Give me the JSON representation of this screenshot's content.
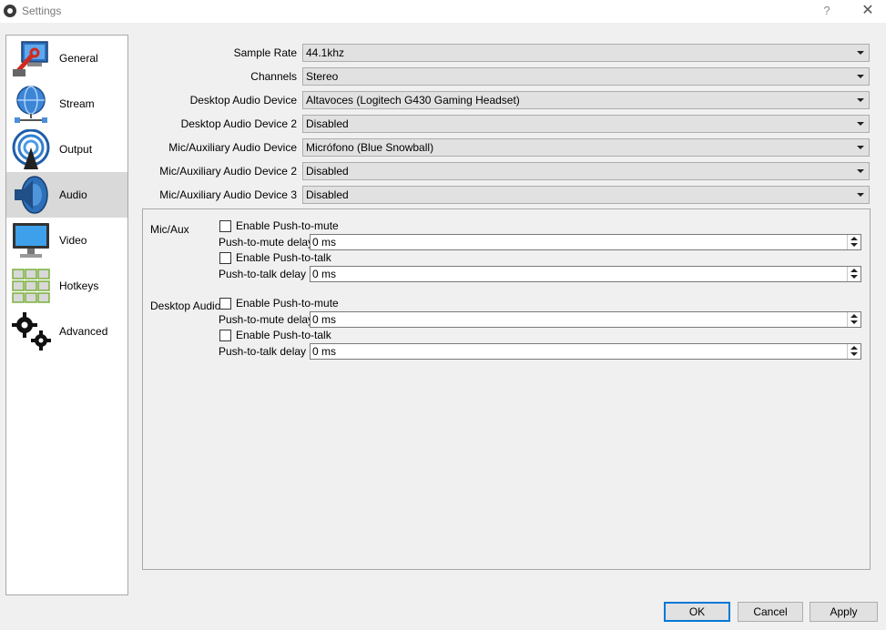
{
  "window": {
    "title": "Settings",
    "help_label": "?",
    "close_label": "✕"
  },
  "sidebar": {
    "items": [
      {
        "label": "General",
        "icon": "computer-wrench-icon",
        "selected": false
      },
      {
        "label": "Stream",
        "icon": "globe-network-icon",
        "selected": false
      },
      {
        "label": "Output",
        "icon": "broadcast-antenna-icon",
        "selected": false
      },
      {
        "label": "Audio",
        "icon": "speaker-icon",
        "selected": true
      },
      {
        "label": "Video",
        "icon": "monitor-icon",
        "selected": false
      },
      {
        "label": "Hotkeys",
        "icon": "keyboard-icon",
        "selected": false
      },
      {
        "label": "Advanced",
        "icon": "gears-icon",
        "selected": false
      }
    ]
  },
  "audio": {
    "fields": [
      {
        "label": "Sample Rate",
        "value": "44.1khz"
      },
      {
        "label": "Channels",
        "value": "Stereo"
      },
      {
        "label": "Desktop Audio Device",
        "value": "Altavoces (Logitech G430 Gaming Headset)"
      },
      {
        "label": "Desktop Audio Device 2",
        "value": "Disabled"
      },
      {
        "label": "Mic/Auxiliary Audio Device",
        "value": "Micrófono (Blue Snowball)"
      },
      {
        "label": "Mic/Auxiliary Audio Device 2",
        "value": "Disabled"
      },
      {
        "label": "Mic/Auxiliary Audio Device 3",
        "value": "Disabled"
      }
    ],
    "hotkey_sections": [
      {
        "title": "Mic/Aux",
        "push_to_mute_label": "Enable Push-to-mute",
        "push_to_mute_checked": false,
        "push_to_mute_delay_label": "Push-to-mute delay",
        "push_to_mute_delay_value": "0 ms",
        "push_to_talk_label": "Enable Push-to-talk",
        "push_to_talk_checked": false,
        "push_to_talk_delay_label": "Push-to-talk delay",
        "push_to_talk_delay_value": "0 ms"
      },
      {
        "title": "Desktop Audio",
        "push_to_mute_label": "Enable Push-to-mute",
        "push_to_mute_checked": false,
        "push_to_mute_delay_label": "Push-to-mute delay",
        "push_to_mute_delay_value": "0 ms",
        "push_to_talk_label": "Enable Push-to-talk",
        "push_to_talk_checked": false,
        "push_to_talk_delay_label": "Push-to-talk delay",
        "push_to_talk_delay_value": "0 ms"
      }
    ]
  },
  "buttons": {
    "ok": "OK",
    "cancel": "Cancel",
    "apply": "Apply"
  },
  "colors": {
    "selected_bg": "#d9d9d9",
    "default_button_border": "#0078d7"
  }
}
